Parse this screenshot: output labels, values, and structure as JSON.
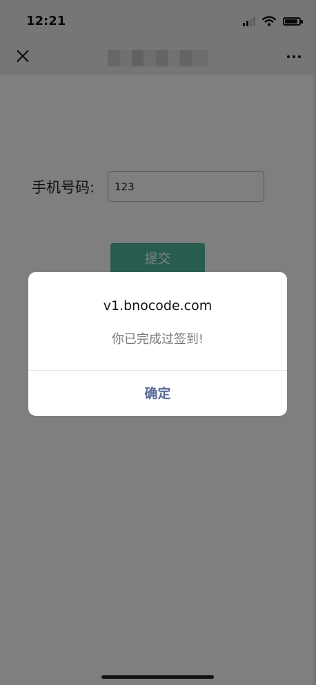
{
  "status_bar": {
    "time": "12:21",
    "icons": [
      "signal-icon",
      "wifi-icon",
      "battery-icon"
    ]
  },
  "nav": {
    "title": "",
    "close_icon": "close-icon",
    "more_icon": "more-icon"
  },
  "form": {
    "phone_label": "手机号码:",
    "phone_value": "123",
    "submit_label": "提交"
  },
  "dialog": {
    "title": "v1.bnocode.com",
    "message": "你已完成过签到!",
    "confirm_label": "确定"
  },
  "colors": {
    "accent": "#4fb89c",
    "dialog_button": "#576b95",
    "overlay": "rgba(0,0,0,0.5)"
  }
}
